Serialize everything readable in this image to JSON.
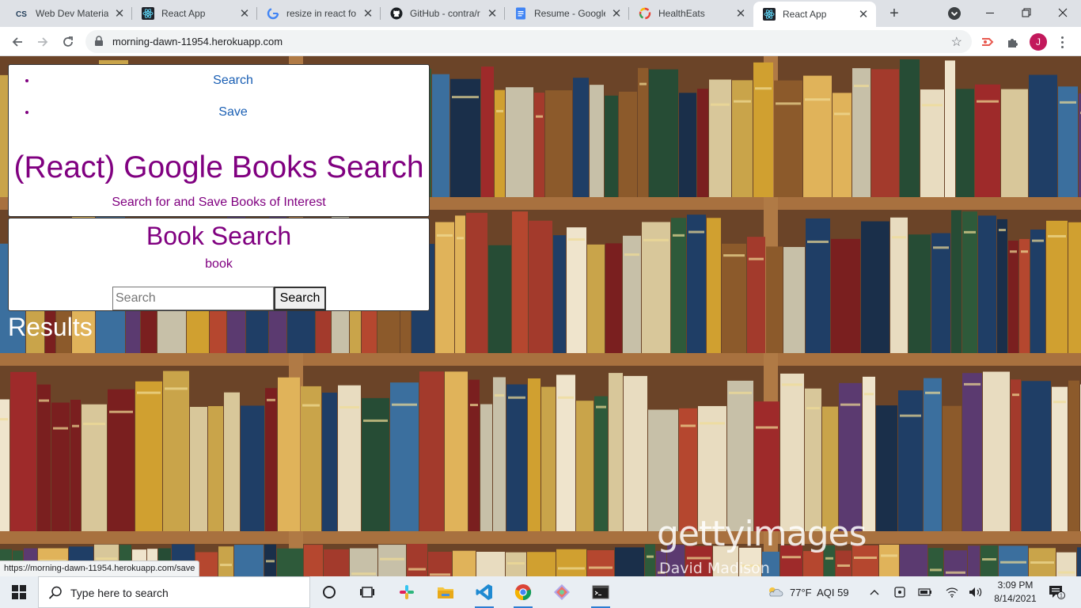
{
  "browser": {
    "tabs": [
      {
        "title": "Web Dev Materia",
        "favicon": "cs-icon",
        "active": false
      },
      {
        "title": "React App",
        "favicon": "react-icon",
        "active": false
      },
      {
        "title": "resize in react fo",
        "favicon": "google-icon",
        "active": false
      },
      {
        "title": "GitHub - contra/r",
        "favicon": "github-icon",
        "active": false
      },
      {
        "title": "Resume - Google",
        "favicon": "google-docs-icon",
        "active": false
      },
      {
        "title": "HealthEats",
        "favicon": "healtheats-icon",
        "active": false
      },
      {
        "title": "React App",
        "favicon": "react-icon",
        "active": true
      }
    ],
    "url": "morning-dawn-11954.herokuapp.com",
    "profile_initial": "J",
    "status_url": "https://morning-dawn-11954.herokuapp.com/save"
  },
  "page": {
    "nav": [
      {
        "label": "Search"
      },
      {
        "label": "Save"
      }
    ],
    "title": "(React) Google Books Search",
    "subtitle": "Search for and Save Books of Interest",
    "search_card": {
      "heading": "Book Search",
      "term": "book",
      "input_placeholder": "Search",
      "button_label": "Search"
    },
    "results_heading": "Results",
    "watermark": {
      "brand": "gettyimages",
      "credit": "David Madison"
    }
  },
  "taskbar": {
    "search_placeholder": "Type here to search",
    "weather": "77°F  AQI 59",
    "time": "3:09 PM",
    "date": "8/14/2021",
    "notification_count": "1"
  },
  "colors": {
    "heading_purple": "#800080",
    "link_blue": "#1a5fb4",
    "taskbar": "#e9eef3",
    "tabstrip": "#dee1e6"
  }
}
